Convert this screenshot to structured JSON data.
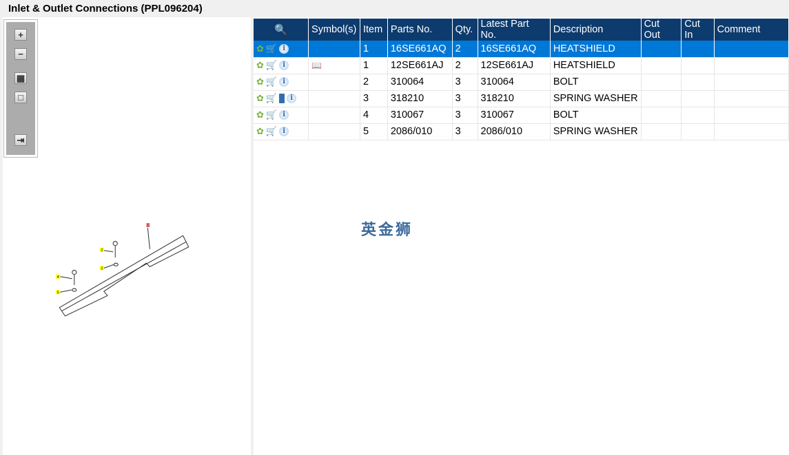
{
  "title": "Inlet & Outlet Connections (PPL096204)",
  "toolbar": {
    "zoom_in": "+",
    "zoom_out": "−",
    "fit_all": "▦",
    "fit_window": "□",
    "export": "⇥"
  },
  "diagram": {
    "callouts": [
      "1",
      "2",
      "3",
      "4",
      "5"
    ]
  },
  "table": {
    "headers": [
      "",
      "Symbol(s)",
      "Item",
      "Parts No.",
      "Qty.",
      "Latest Part No.",
      "Description",
      "Cut Out",
      "Cut In",
      "Comment"
    ],
    "rows": [
      {
        "item": "1",
        "part": "16SE661AQ",
        "qty": "2",
        "latest": "16SE661AQ",
        "desc": "HEATSHIELD",
        "book": false,
        "symbol": false,
        "selected": true
      },
      {
        "item": "1",
        "part": "12SE661AJ",
        "qty": "2",
        "latest": "12SE661AJ",
        "desc": "HEATSHIELD",
        "book": false,
        "symbol": true
      },
      {
        "item": "2",
        "part": "310064",
        "qty": "3",
        "latest": "310064",
        "desc": "BOLT",
        "book": false,
        "symbol": false
      },
      {
        "item": "3",
        "part": "318210",
        "qty": "3",
        "latest": "318210",
        "desc": "SPRING WASHER",
        "book": true,
        "symbol": false
      },
      {
        "item": "4",
        "part": "310067",
        "qty": "3",
        "latest": "310067",
        "desc": "BOLT",
        "book": false,
        "symbol": false
      },
      {
        "item": "5",
        "part": "2086/010",
        "qty": "3",
        "latest": "2086/010",
        "desc": "SPRING WASHER",
        "book": false,
        "symbol": false
      }
    ]
  },
  "watermark": "英金狮"
}
